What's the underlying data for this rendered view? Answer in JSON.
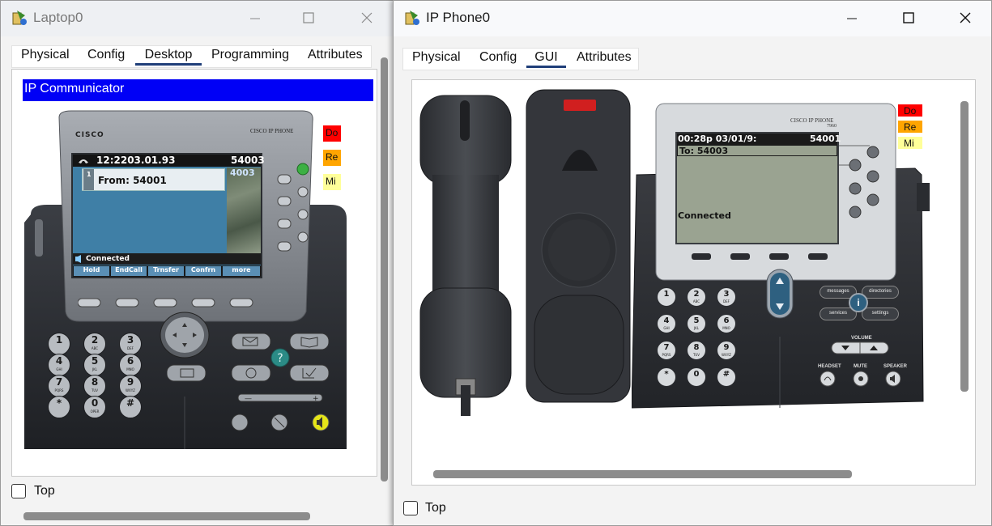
{
  "laptop": {
    "title": "Laptop0",
    "tabs": [
      {
        "label": "Physical"
      },
      {
        "label": "Config"
      },
      {
        "label": "Desktop"
      },
      {
        "label": "Programming"
      },
      {
        "label": "Attributes"
      }
    ],
    "active_tab": "Desktop",
    "app_bar": "IP Communicator",
    "status_buttons": [
      "Do",
      "Re",
      "Mi"
    ],
    "phone": {
      "brand": "CISCO",
      "model": "CISCO IP PHONE",
      "time_date": "12:2203.01.93",
      "extension": "54003",
      "line_label": "From: 54001",
      "line_number": "1",
      "side_ext": "4003",
      "status": "Connected",
      "softkeys": [
        "Hold",
        "EndCall",
        "Trnsfer",
        "Confrn",
        "more"
      ],
      "keypad": [
        {
          "d": "1",
          "l": ""
        },
        {
          "d": "2",
          "l": "ABC"
        },
        {
          "d": "3",
          "l": "DEF"
        },
        {
          "d": "4",
          "l": "GHI"
        },
        {
          "d": "5",
          "l": "JKL"
        },
        {
          "d": "6",
          "l": "MNO"
        },
        {
          "d": "7",
          "l": "PQRS"
        },
        {
          "d": "8",
          "l": "TUV"
        },
        {
          "d": "9",
          "l": "WXYZ"
        },
        {
          "d": "*",
          "l": ""
        },
        {
          "d": "0",
          "l": "OPER"
        },
        {
          "d": "#",
          "l": ""
        }
      ]
    },
    "top_label": "Top"
  },
  "ipphone": {
    "title": "IP Phone0",
    "tabs": [
      {
        "label": "Physical"
      },
      {
        "label": "Config"
      },
      {
        "label": "GUI"
      },
      {
        "label": "Attributes"
      }
    ],
    "active_tab": "GUI",
    "status_buttons": [
      "Do",
      "Re",
      "Mi"
    ],
    "phone": {
      "model": "CISCO IP PHONE",
      "model_number": "7960",
      "time_date": "00:28p 03/01/9:",
      "extension": "54001",
      "to_line": "To: 54003",
      "status": "Connected",
      "buttons": {
        "messages": "messages",
        "directories": "directories",
        "services": "services",
        "settings": "settings",
        "info": "i",
        "volume": "VOLUME",
        "headset": "HEADSET",
        "mute": "MUTE",
        "speaker": "SPEAKER"
      },
      "keypad": [
        {
          "d": "1",
          "l": ""
        },
        {
          "d": "2",
          "l": "ABC"
        },
        {
          "d": "3",
          "l": "DEF"
        },
        {
          "d": "4",
          "l": "GHI"
        },
        {
          "d": "5",
          "l": "JKL"
        },
        {
          "d": "6",
          "l": "MNO"
        },
        {
          "d": "7",
          "l": "PQRS"
        },
        {
          "d": "8",
          "l": "TUV"
        },
        {
          "d": "9",
          "l": "WXYZ"
        },
        {
          "d": "*",
          "l": ""
        },
        {
          "d": "0",
          "l": ""
        },
        {
          "d": "#",
          "l": ""
        }
      ]
    },
    "top_label": "Top"
  },
  "colors": {
    "blue_bar": "#0000f6",
    "do": "#ff0000",
    "re": "#ffa500",
    "mi": "#ffff99",
    "lcd_blue": "#3f7fa6",
    "lcd_grey": "#9aa391",
    "tab_underline": "#1f3e79"
  }
}
